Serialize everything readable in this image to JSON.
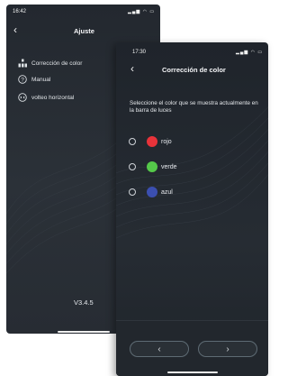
{
  "settings_screen": {
    "status_time": "16:42",
    "status_icons": "signal wifi battery",
    "back_symbol": "‹",
    "title": "Ajuste",
    "menu": [
      {
        "label": "Corrección de color",
        "icon": "color-bars-icon"
      },
      {
        "label": "Manual",
        "icon": "help-circle-icon"
      },
      {
        "label": "volteo horizontal",
        "icon": "flip-icon"
      }
    ],
    "version": "V3.4.5"
  },
  "color_screen": {
    "status_time": "17:30",
    "back_symbol": "‹",
    "title": "Corrección de color",
    "instruction": "Seleccione el color que se muestra actualmente en la barra de luces",
    "options": [
      {
        "label": "rojo",
        "color": "#e8333a",
        "selected": false
      },
      {
        "label": "verde",
        "color": "#55c94a",
        "selected": false
      },
      {
        "label": "azul",
        "color": "#3b4fb0",
        "selected": false
      }
    ],
    "prev_symbol": "‹",
    "next_symbol": "›"
  },
  "colors": {
    "background": "#23282f",
    "text": "#e8ebef",
    "button_border": "#5e6b74"
  }
}
